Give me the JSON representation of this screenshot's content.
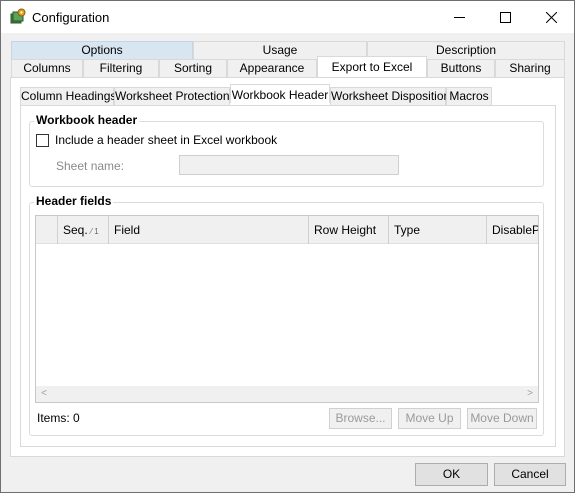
{
  "window": {
    "title": "Configuration",
    "icon": "configuration-app-icon",
    "controls": [
      "minimize-icon",
      "maximize-icon",
      "close-icon"
    ]
  },
  "tabs_level1": {
    "row1": [
      "Options",
      "Usage",
      "Description"
    ],
    "row2": [
      "Columns",
      "Filtering",
      "Sorting",
      "Appearance",
      "Export to Excel",
      "Buttons",
      "Sharing"
    ],
    "selected": "Export to Excel"
  },
  "tabs_level2": {
    "items": [
      "Column Headings",
      "Worksheet Protection",
      "Workbook Header",
      "Worksheet Disposition",
      "Macros"
    ],
    "selected": "Workbook Header"
  },
  "workbook_header": {
    "title": "Workbook header",
    "checkbox_label": "Include a header sheet in Excel workbook",
    "checked": false,
    "sheet_name_label": "Sheet name:",
    "sheet_name_value": ""
  },
  "header_fields": {
    "title": "Header fields",
    "columns": {
      "seq": "Seq.",
      "seq_sort": "1",
      "field": "Field",
      "row_height": "Row Height",
      "type": "Type",
      "disable": "DisableP"
    },
    "rows": [],
    "items_label": "Items: 0",
    "browse_label": "Browse...",
    "move_up_label": "Move Up",
    "move_down_label": "Move Down"
  },
  "dialog": {
    "ok_label": "OK",
    "cancel_label": "Cancel"
  }
}
